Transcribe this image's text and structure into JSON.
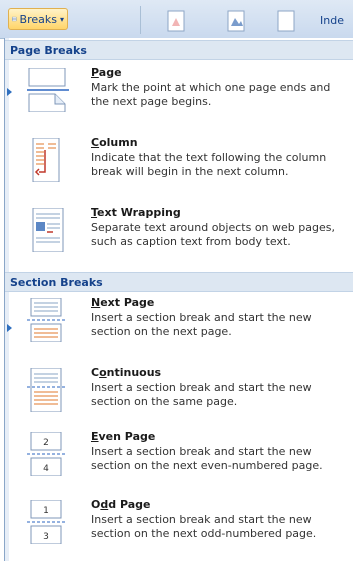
{
  "ribbon": {
    "breaks_label": "Breaks",
    "indent_label": "Inde"
  },
  "menu": {
    "sections": [
      {
        "header": "Page Breaks",
        "items": [
          {
            "title": "Page",
            "accel": "P",
            "rest": "age",
            "desc": "Mark the point at which one page ends and the next page begins."
          },
          {
            "title": "Column",
            "accel": "C",
            "rest": "olumn",
            "desc": "Indicate that the text following the column break will begin in the next column."
          },
          {
            "title": "Text Wrapping",
            "accel": "T",
            "rest": "ext Wrapping",
            "desc": "Separate text around objects on web pages, such as caption text from body text."
          }
        ]
      },
      {
        "header": "Section Breaks",
        "items": [
          {
            "title": "Next Page",
            "accel": "N",
            "rest": "ext Page",
            "desc": "Insert a section break and start the new section on the next page."
          },
          {
            "title": "Continuous",
            "accel": "o",
            "pre": "C",
            "rest": "ntinuous",
            "desc": "Insert a section break and start the new section on the same page."
          },
          {
            "title": "Even Page",
            "accel": "E",
            "rest": "ven Page",
            "desc": "Insert a section break and start the new section on the next even-numbered page."
          },
          {
            "title": "Odd Page",
            "accel": "d",
            "pre": "O",
            "rest": "d Page",
            "desc": "Insert a section break and start the new section on the next odd-numbered page."
          }
        ]
      }
    ],
    "icon_numbers": {
      "even_top": "2",
      "even_bottom": "4",
      "odd_top": "1",
      "odd_bottom": "3"
    }
  }
}
